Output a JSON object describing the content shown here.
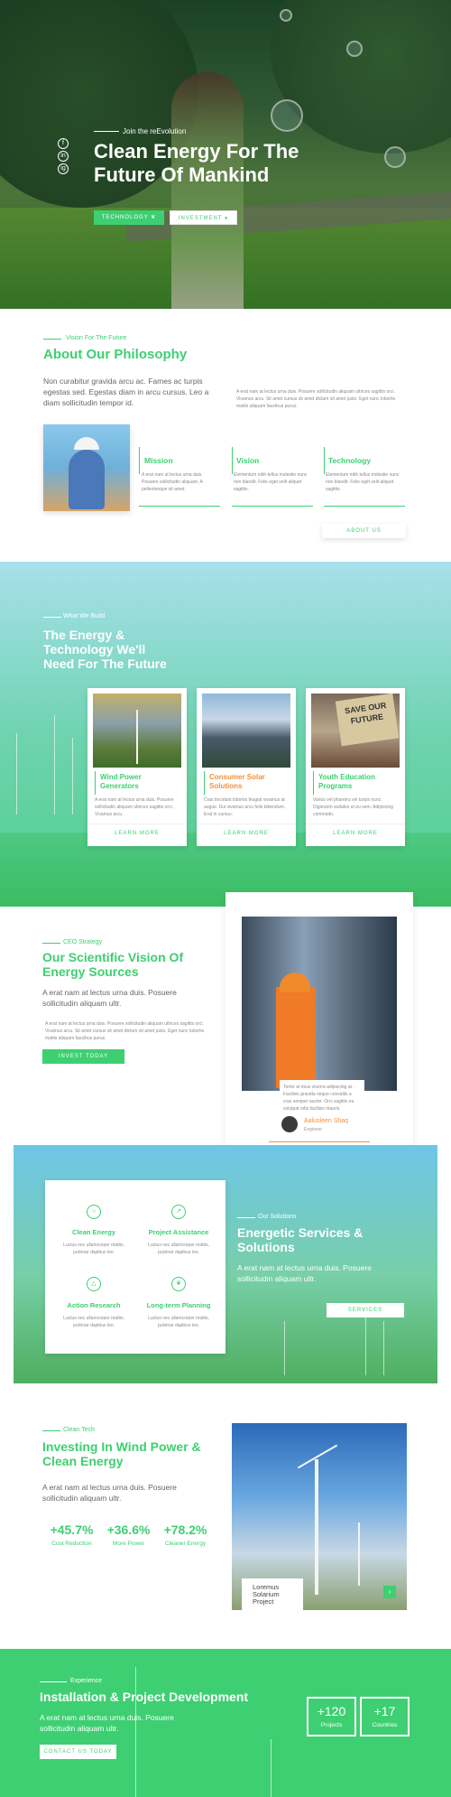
{
  "hero": {
    "kicker": "Join the reEvolution",
    "title_line1": "Clean Energy For The",
    "title_line2": "Future Of Mankind",
    "btn_technology": "TECHNOLOGY",
    "btn_investment": "INVESTMENT",
    "social": [
      "f",
      "in",
      "ig"
    ]
  },
  "philosophy": {
    "kicker": "Vision For The Future",
    "title": "About Our Philosophy",
    "intro": "Non curabitur gravida arcu ac. Fames ac turpis egestas sed. Egestas diam in arcu cursus. Leo a diam sollicitudin tempor id.",
    "side_text": "A erat nam at lectus urna duis. Posuere sollicitudin aliquam ultrices sagittis orci. Vivamus arcu. Sit amet cursus sit amet dictum sit amet justo. Eget nunc lobortis mattis aliquam faucibus purus.",
    "items": [
      {
        "title": "Mission",
        "text": "A erat nam at lectus urna duis. Posuere sollicitudin aliquam. A pellentesque sit amet."
      },
      {
        "title": "Vision",
        "text": "Elementum nibh tellus molestie nunc non blandit. Felis eget velit aliquet sagittis."
      },
      {
        "title": "Technology",
        "text": "Elementum nibh tellus molestie nunc non blandit. Felis eget velit aliquet sagittis."
      }
    ],
    "button": "ABOUT US"
  },
  "build": {
    "kicker": "What We Build",
    "title_line1": "The Energy &",
    "title_line2": "Technology We'll",
    "title_line3": "Need For The Future",
    "cards": [
      {
        "title": "Wind Power Generators",
        "text": "A erat nam at lectus urna duis. Posuere sollicitudin aliquam ultrices sagittis orci. Vivamus arcu.",
        "link": "LEARN MORE"
      },
      {
        "title": "Consumer Solar Solutions",
        "text": "Cras tincidunt lobortis feugiat vivamus at augue. Dui vivamus arcu felis bibendum. Erat in cursus.",
        "link": "LEARN MORE"
      },
      {
        "title": "Youth Education Programs",
        "text": "Varius vel pharetra vel turpis nunc. Dignissim sodales ut eu sem. Adipiscing commodo.",
        "link": "LEARN MORE"
      }
    ],
    "sign_text": "SAVE OUR FUTURE"
  },
  "vision": {
    "kicker": "CEO Strategy",
    "title_line1": "Our Scientific Vision Of",
    "title_line2": "Energy Sources",
    "intro": "A erat nam at lectus urna duis. Posuere sollicitudin aliquam ultr.",
    "text": "A erat nam at lectus urna duis. Posuere sollicitudin aliquam ultrices sagittis orci. Vivamus arcu. Sit amet cursus sit amet dictum sit amet justo. Eget nunc lobortis mattis aliquam faucibus purus.",
    "button": "INVEST TODAY",
    "quote": "Tortor at risus viverra adipiscing at. Facilisis gravida neque convallis a cras semper auctor. Orci sagittis eu volutpat odio facilisis mauris.",
    "person_name": "Aalusleen Shaq",
    "person_role": "Engineer"
  },
  "services": {
    "items": [
      {
        "title": "Clean Energy",
        "text": "Luctus nec ullamcorper mattis, pulvinar dapibus leo."
      },
      {
        "title": "Project Assistance",
        "text": "Luctus nec ullamcorper mattis, pulvinar dapibus leo."
      },
      {
        "title": "Action Research",
        "text": "Luctus nec ullamcorper mattis, pulvinar dapibus leo."
      },
      {
        "title": "Long-term Planning",
        "text": "Luctus nec ullamcorper mattis, pulvinar dapibus leo."
      }
    ],
    "kicker": "Our Solutions",
    "title_line1": "Energetic Services &",
    "title_line2": "Solutions",
    "text": "A erat nam at lectus urna duis. Posuere sollicitudin aliquam ultr.",
    "button": "SERVICES"
  },
  "wind": {
    "kicker": "Clean Tech",
    "title_line1": "Investing In Wind Power &",
    "title_line2": "Clean Energy",
    "text": "A erat nam at lectus urna duis. Posuere sollicitudin aliquam ultr.",
    "stats": [
      {
        "value": "+45.7%",
        "label": "Cost Reduction"
      },
      {
        "value": "+36.6%",
        "label": "More Power"
      },
      {
        "value": "+78.2%",
        "label": "Cleaner Energy"
      }
    ],
    "project_line1": "Loremus",
    "project_line2": "Solarium",
    "project_line3": "Project"
  },
  "install": {
    "kicker": "Experience",
    "title": "Installation & Project Development",
    "text": "A erat nam at lectus urna duis. Posuere sollicitudin aliquam ultr.",
    "button": "CONTACT US TODAY",
    "stats": [
      {
        "value": "+120",
        "label": "Projects"
      },
      {
        "value": "+17",
        "label": "Countries"
      }
    ]
  },
  "colors": {
    "accent": "#3ecf72",
    "orange": "#f0903a"
  }
}
